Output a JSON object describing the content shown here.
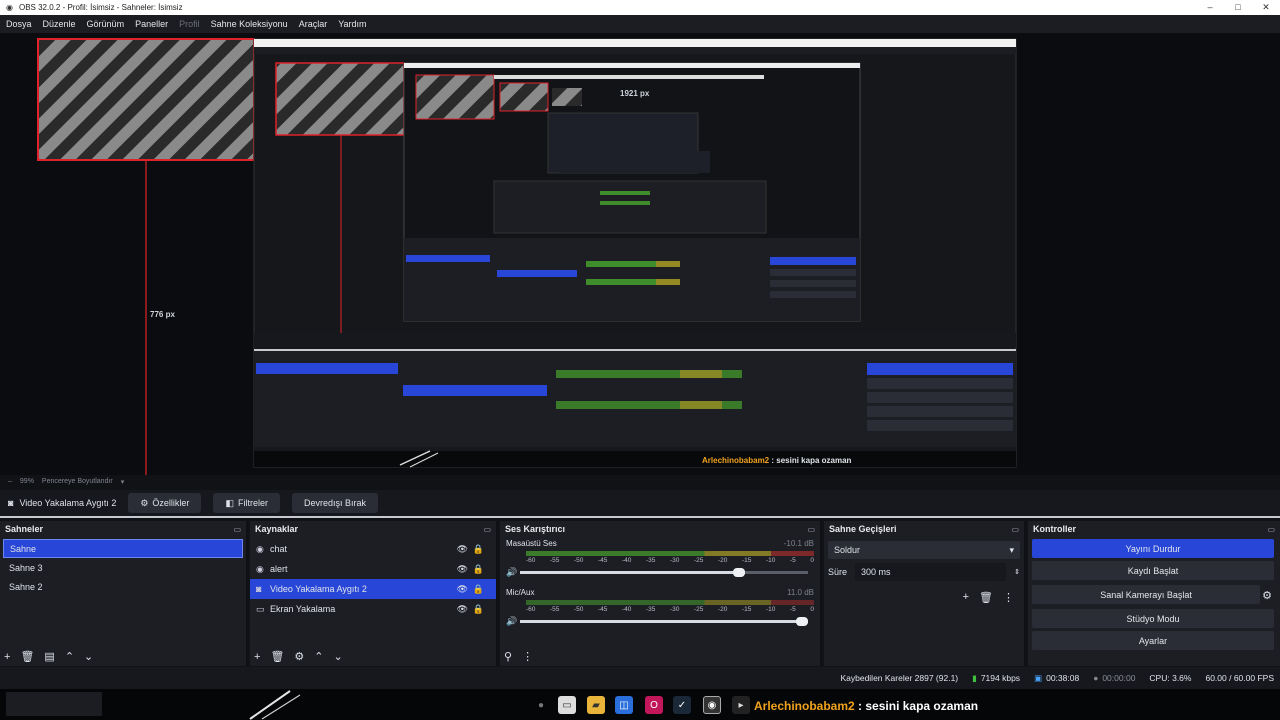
{
  "window": {
    "title": "OBS 32.0.2 - Profil: İsimsiz - Sahneler: İsimsiz",
    "min": "–",
    "max": "□",
    "close": "✕"
  },
  "menu": {
    "items": [
      "Dosya",
      "Düzenle",
      "Görünüm",
      "Paneller",
      "Profil",
      "Sahne Koleksiyonu",
      "Araçlar",
      "Yardım"
    ]
  },
  "preview": {
    "ruler_h": "776 px",
    "ruler_top": "1921 px",
    "nested_chat_user": "Arlechinobabam2",
    "nested_chat_msg": ": sesini kapa ozaman"
  },
  "zoom": {
    "value": "99%",
    "mode": "Pencereye Boyutlandır"
  },
  "source_toolbar": {
    "source": "Video Yakalama Aygıtı 2",
    "properties": "Özellikler",
    "filters": "Filtreler",
    "deactivate": "Devredışı Bırak"
  },
  "scenes": {
    "title": "Sahneler",
    "items": [
      "Sahne",
      "Sahne 3",
      "Sahne 2"
    ],
    "selected": 0
  },
  "sources": {
    "title": "Kaynaklar",
    "items": [
      {
        "name": "chat",
        "icon": "chat-icon"
      },
      {
        "name": "alert",
        "icon": "alert-icon"
      },
      {
        "name": "Video Yakalama Aygıtı 2",
        "icon": "camera-icon"
      },
      {
        "name": "Ekran Yakalama",
        "icon": "monitor-icon"
      }
    ],
    "selected": 2
  },
  "mixer": {
    "title": "Ses Karıştırıcı",
    "ticks": [
      "-60",
      "-55",
      "-50",
      "-45",
      "-40",
      "-35",
      "-30",
      "-25",
      "-20",
      "-15",
      "-10",
      "-5",
      "0"
    ],
    "channels": [
      {
        "name": "Masaüstü Ses",
        "db": "-10.1 dB",
        "volume": 0.78
      },
      {
        "name": "Mic/Aux",
        "db": "11.0 dB",
        "volume": 1.0
      }
    ]
  },
  "transitions": {
    "title": "Sahne Geçişleri",
    "selected": "Soldur",
    "duration_label": "Süre",
    "duration": "300 ms"
  },
  "controls": {
    "title": "Kontroller",
    "stream": "Yayını Durdur",
    "record": "Kaydı Başlat",
    "vcam": "Sanal Kamerayı Başlat",
    "studio": "Stüdyo Modu",
    "settings": "Ayarlar"
  },
  "status": {
    "dropped": "Kaybedilen Kareler 2897 (92.1)",
    "bitrate": "7194 kbps",
    "stream_time": "00:38:08",
    "rec_time": "00:00:00",
    "cpu": "CPU: 3.6%",
    "fps": "60.00 / 60.00 FPS"
  },
  "taskbar": {
    "chat_user": "Arlechinobabam2",
    "chat_msg": ": sesini kapa ozaman"
  },
  "colors": {
    "accent": "#2847d8",
    "panel": "#1c1e24",
    "bg": "#101216",
    "hatch": "#8a8a8a",
    "outline": "#e0222a"
  }
}
